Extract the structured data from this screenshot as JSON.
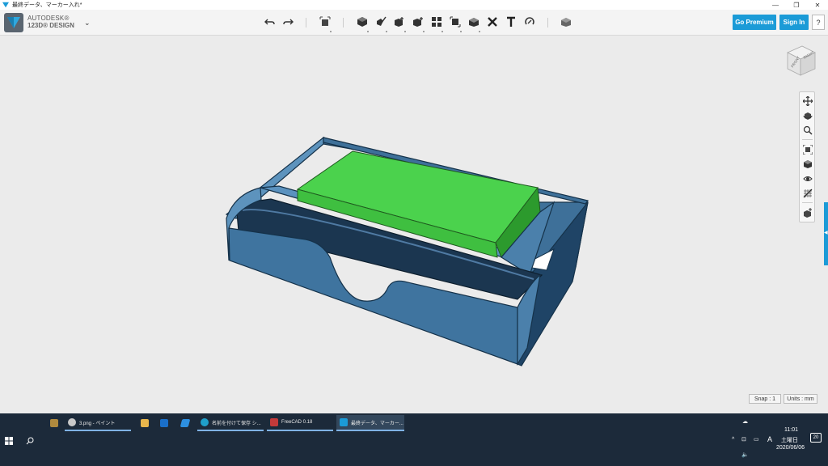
{
  "window": {
    "title": "最終データ、マーカー入れ*",
    "minimize": "—",
    "maximize": "❐",
    "close": "✕"
  },
  "app": {
    "brand_line1": "AUTODESK®",
    "brand_line2": "123D® DESIGN",
    "menu_caret": "⌄",
    "go_premium": "Go Premium",
    "sign_in": "Sign In",
    "help": "?"
  },
  "toolbar": {
    "tools": [
      {
        "name": "undo-icon",
        "glyph": "↶"
      },
      {
        "name": "redo-icon",
        "glyph": "↷"
      },
      {
        "name": "transform-icon",
        "glyph": "⬚"
      },
      {
        "name": "primitives-icon",
        "glyph": "◆"
      },
      {
        "name": "sketch-icon",
        "glyph": "✎"
      },
      {
        "name": "construct-icon",
        "glyph": "◆"
      },
      {
        "name": "modify-icon",
        "glyph": "◆"
      },
      {
        "name": "pattern-icon",
        "glyph": "▦"
      },
      {
        "name": "grouping-icon",
        "glyph": "⬚"
      },
      {
        "name": "combine-icon",
        "glyph": "◆"
      },
      {
        "name": "delete-icon",
        "glyph": "✕"
      },
      {
        "name": "text-icon",
        "glyph": "T"
      },
      {
        "name": "snap-icon",
        "glyph": "⟲"
      },
      {
        "name": "material-icon",
        "glyph": "◆"
      }
    ]
  },
  "viewcube": {
    "front": "FRONT",
    "right": "RIGHT"
  },
  "status": {
    "snap": "Snap : 1",
    "units": "Units : mm"
  },
  "colors": {
    "accent": "#1b9bd7",
    "model_blue": "#3d6f99",
    "model_dark": "#1e3d58",
    "block_green": "#49d14a",
    "taskbar": "#1c2a3a"
  },
  "taskbar": {
    "items": [
      {
        "label": "3.png - ペイント"
      },
      {
        "label": "名前を付けて保存 シ..."
      },
      {
        "label": "FreeCAD 0.18"
      },
      {
        "label": "最終データ、マーカー..."
      }
    ],
    "ime": "A",
    "time": "11:01",
    "day": "土曜日",
    "date": "2020/06/06",
    "notifications": "20"
  }
}
